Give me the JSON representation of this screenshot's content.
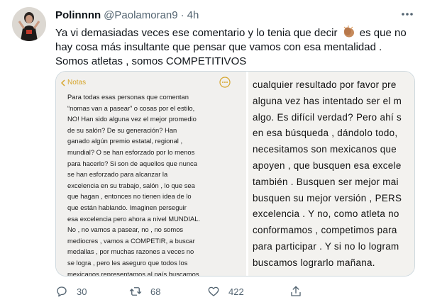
{
  "tweet": {
    "display_name": "Polinnnn",
    "handle": "@Paolamoran9",
    "separator": "·",
    "time": "4h",
    "text_part1": "Ya vi demasiadas veces ese comentario y lo tenia que decir",
    "text_part2": "es que no hay cosa más insultante que pensar que vamos con esa mentalidad . Somos atletas , somos COMPETITIVOS",
    "emoji": "clapping-hands-medium-skin-tone-emoji"
  },
  "media": {
    "notes_back_label": "Notas",
    "left_lines": [
      "Para todas esas personas que comentan",
      "“nomas van a pasear” o cosas por el estilo,",
      "NO! Han sido alguna vez el mejor promedio",
      "de su salón? De su generación? Han",
      "ganado algún premio estatal,  regional ,",
      "mundial? O se han esforzado por lo menos",
      "para hacerlo? Si son de aquellos que nunca",
      "se han esforzado para alcanzar la",
      "excelencia en su trabajo, salón , lo que sea",
      "que hagan , entonces no tienen idea de lo",
      "que están hablando. Imaginen perseguir",
      "esa excelencia pero ahora a nivel MUNDIAL.",
      "No , no vamos a pasear, no , no somos",
      "mediocres , vamos a COMPETIR, a buscar",
      "medallas , por muchas razones a veces no",
      "se logra , pero les aseguro que todos los",
      "mexicanos representamos al país buscamos"
    ],
    "right_lines": [
      "cualquier resultado por favor pre",
      "alguna vez has intentado ser el m",
      "algo. Es difícil verdad? Pero ahí s",
      "en esa búsqueda , dándolo todo,",
      "necesitamos son mexicanos que",
      "apoyen , que busquen esa excele",
      "también . Busquen ser mejor mai",
      "busquen su mejor versión , PERS",
      "excelencia . Y no, como atleta no",
      "conformamos , competimos para",
      "para participar . Y si no lo logram",
      "buscamos lograrlo mañana."
    ]
  },
  "actions": {
    "reply_count": "30",
    "retweet_count": "68",
    "like_count": "422"
  },
  "colors": {
    "text": "#0f1419",
    "secondary": "#536471",
    "notes_accent": "#d6a52b",
    "border": "#cfd9de"
  }
}
